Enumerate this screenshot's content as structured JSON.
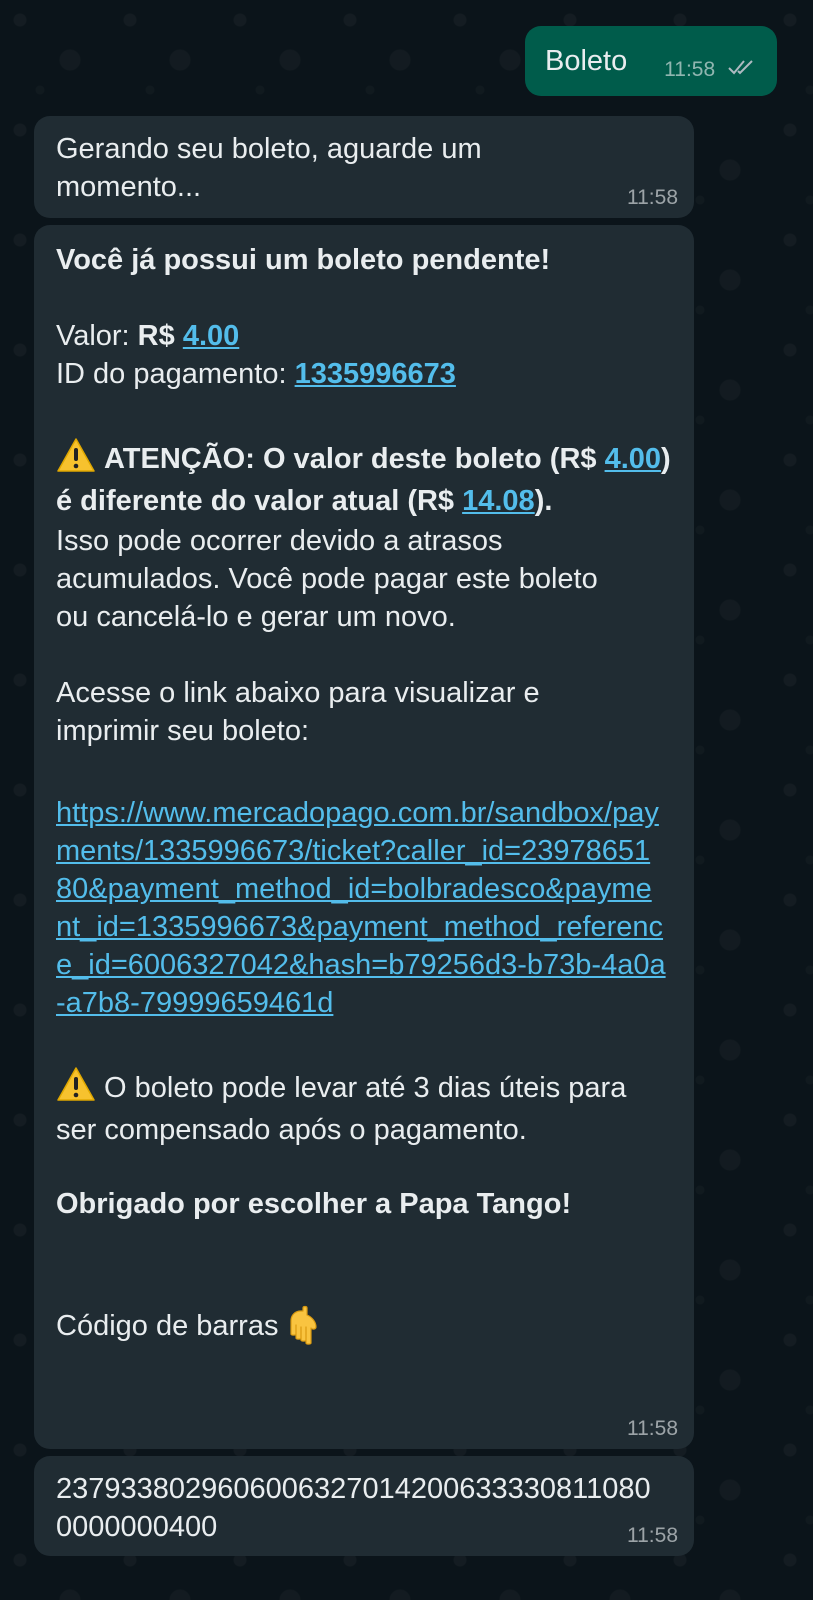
{
  "outgoing_message": {
    "text": "Boleto",
    "time": "11:58",
    "status_icon": "double-check-icon"
  },
  "message_generating": {
    "text": "Gerando seu boleto, aguarde um momento...",
    "time": "11:58"
  },
  "message_boleto": {
    "heading": "Você já possui um boleto pendente!",
    "valor_label": "Valor: ",
    "valor_currency": "R$ ",
    "valor_amount": "4.00",
    "id_label": "ID do pagamento: ",
    "id_value": "1335996673",
    "warning_icon": "warning-icon",
    "warning_prefix": "ATENÇÃO: O valor deste boleto (R$ ",
    "warning_old_amount": "4.00",
    "warning_middle": ") é diferente do valor atual (R$ ",
    "warning_new_amount": "14.08",
    "warning_suffix": ").",
    "explanation": "Isso pode ocorrer devido a atrasos acumulados. Você pode pagar este boleto ou cancelá-lo e gerar um novo.",
    "link_intro": "Acesse o link abaixo para visualizar e imprimir seu boleto:",
    "link_url": "https://www.mercadopago.com.br/sandbox/payments/1335996673/ticket?caller_id=2397865180&payment_method_id=bolbradesco&payment_id=1335996673&payment_method_reference_id=6006327042&hash=b79256d3-b73b-4a0a-a7b8-79999659461d",
    "note": "O boleto pode levar até 3 dias úteis para ser compensado após o pagamento.",
    "thanks": "Obrigado por escolher a Papa Tango!",
    "barcode_label": "Código de barras",
    "barcode_icon": "pointing-down-hand-icon",
    "time": "11:58"
  },
  "message_barcode": {
    "code": "23793380296060063270142006333308110800000000400",
    "time": "11:58"
  },
  "colors": {
    "background": "#0b141a",
    "incoming_bubble": "#202c33",
    "outgoing_bubble": "#005c4b",
    "link": "#53bdeb",
    "text": "#e9edef"
  }
}
